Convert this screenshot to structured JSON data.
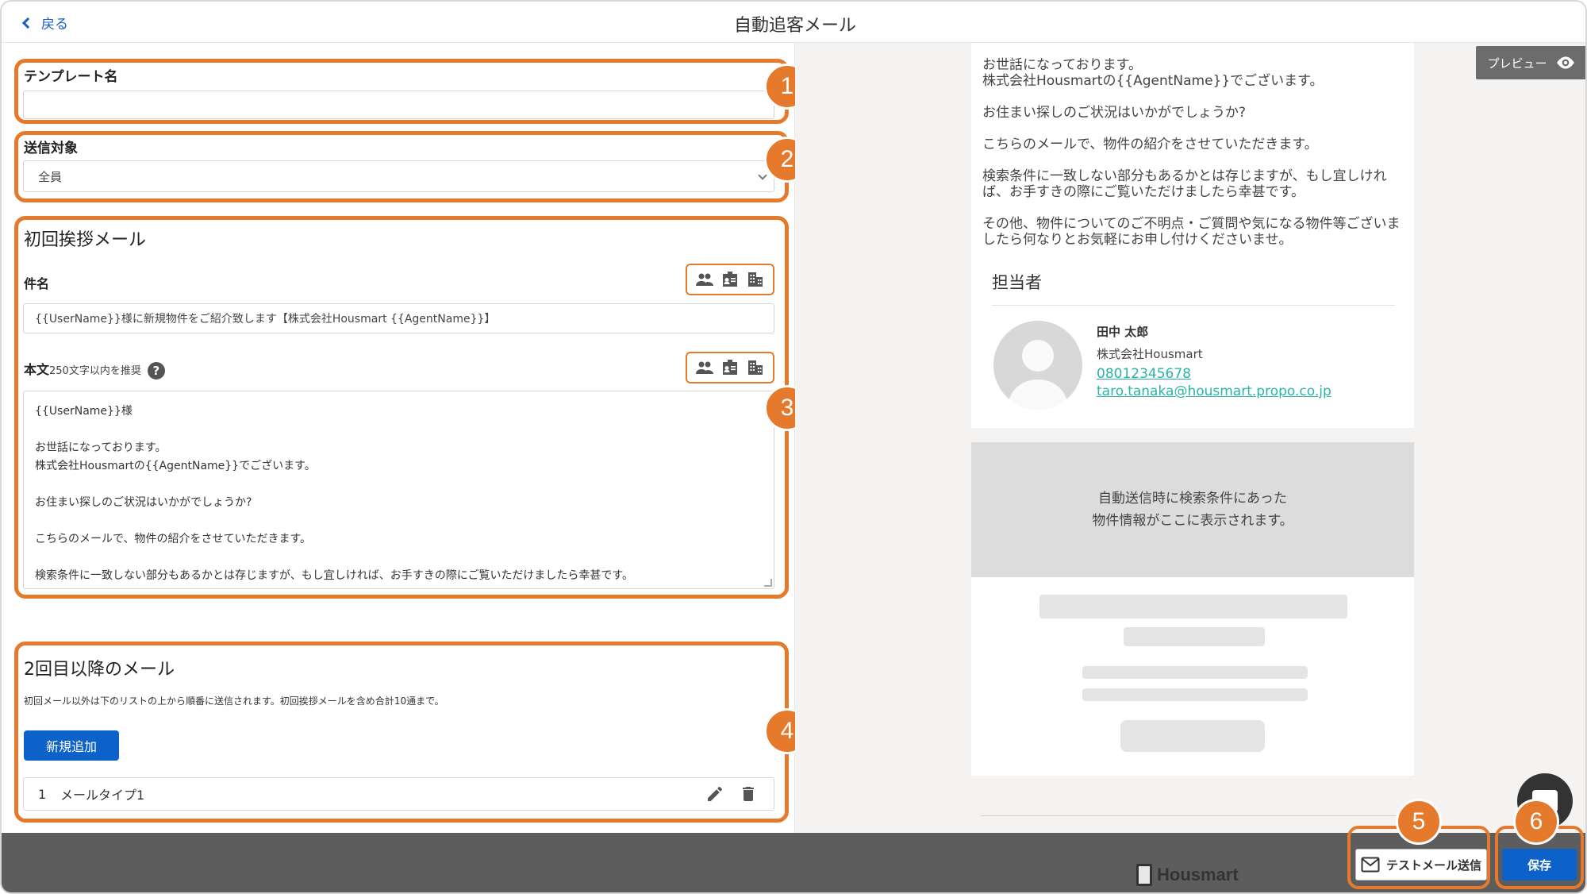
{
  "header": {
    "back_label": "戻る",
    "title": "自動追客メール"
  },
  "template_name": {
    "label": "テンプレート名",
    "value": ""
  },
  "target": {
    "label": "送信対象",
    "selected": "全員"
  },
  "first_mail": {
    "heading": "初回挨拶メール",
    "subject_label": "件名",
    "subject_value": "{{UserName}}様に新規物件をご紹介致します【株式会社Housmart {{AgentName}}】",
    "body_label": "本文",
    "body_hint": "250文字以内を推奨",
    "help_icon": "?",
    "body_lines": [
      "{{UserName}}様",
      "",
      "お世話になっております。",
      "株式会社Housmartの{{AgentName}}でございます。",
      "",
      "お住まい探しのご状況はいかがでしょうか?",
      "",
      "こちらのメールで、物件の紹介をさせていただきます。",
      "",
      "検索条件に一致しない部分もあるかとは存じますが、もし宜しければ、お手すきの際にご覧いただけましたら幸甚です。"
    ]
  },
  "followup": {
    "heading": "2回目以降のメール",
    "description": "初回メール以外は下のリストの上から順番に送信されます。初回挨拶メールを含め合計10通まで。",
    "add_button": "新規追加",
    "rows": [
      {
        "num": "1",
        "label": "メールタイプ1"
      }
    ]
  },
  "preview": {
    "button_label": "プレビュー",
    "paragraphs": [
      "お世話になっております。\n株式会社Housmartの{{AgentName}}でございます。",
      "お住まい探しのご状況はいかがでしょうか?",
      "こちらのメールで、物件の紹介をさせていただきます。",
      "検索条件に一致しない部分もあるかとは存じますが、もし宜しければ、お手すきの際にご覧いただけましたら幸甚です。",
      "その他、物件についてのご不明点・ご質問や気になる物件等ございましたら何なりとお気軽にお申し付けくださいませ。"
    ],
    "staff_heading": "担当者",
    "staff_name": "田中 太郎",
    "staff_company": "株式会社Housmart",
    "staff_phone": "08012345678",
    "staff_email": "taro.tanaka@housmart.propo.co.jp",
    "placeholder_line1": "自動送信時に検索条件にあった",
    "placeholder_line2": "物件情報がここに表示されます。"
  },
  "footer": {
    "logo_text": "Housmart",
    "test_button": "テストメール送信",
    "save_button": "保存"
  },
  "annotations": [
    "1",
    "2",
    "3",
    "4",
    "5",
    "6"
  ],
  "colors": {
    "accent_orange": "#e57a2d",
    "primary_blue": "#0d62c9",
    "link_teal": "#2ab3a6"
  }
}
